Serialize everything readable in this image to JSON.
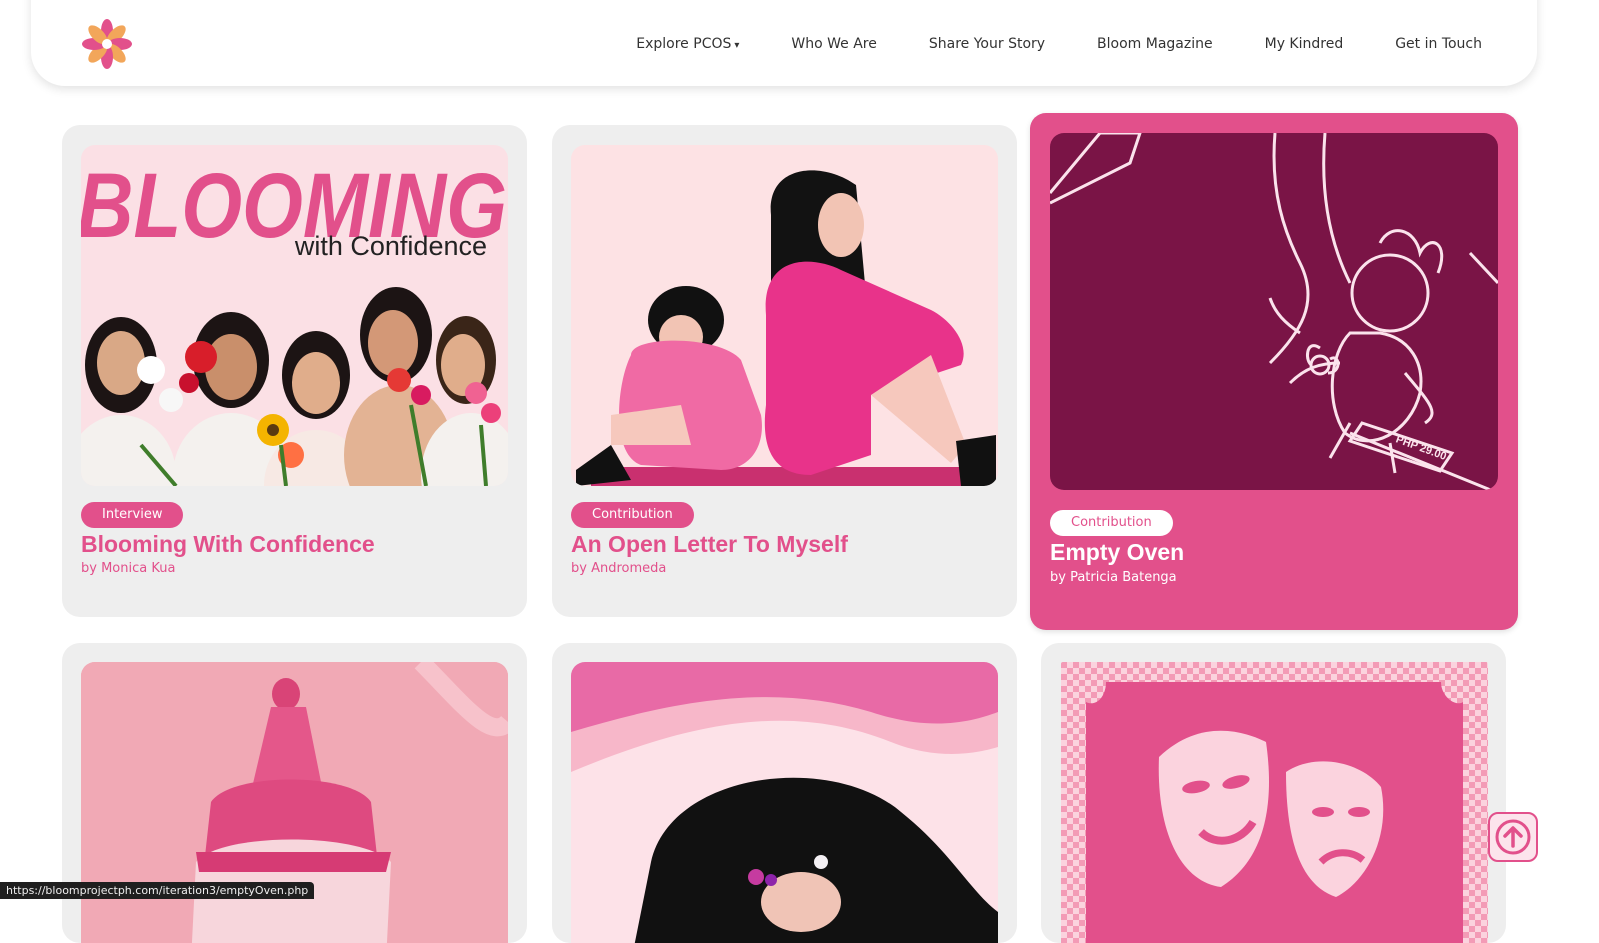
{
  "nav": {
    "logo_alt": "flower-logo",
    "links": [
      "Explore PCOS",
      "Who We Are",
      "Share Your Story",
      "Bloom Magazine",
      "My Kindred",
      "Get in Touch"
    ],
    "dropdown_caret": "▾"
  },
  "cards": [
    {
      "tag": "Interview",
      "title": "Blooming With Confidence",
      "author": "by Monica Kua",
      "image_text": {
        "headline": "BLOOMING",
        "sub": "with Confidence"
      }
    },
    {
      "tag": "Contribution",
      "title": "An Open Letter To Myself",
      "author": "by Andromeda"
    },
    {
      "tag": "Contribution",
      "title": "Empty Oven",
      "author": "by Patricia Batenga",
      "image_text": {
        "tag_text": "PHP 29.00"
      }
    }
  ],
  "status_url": "https://bloomprojectph.com/iteration3/emptyOven.php",
  "colors": {
    "accent": "#e2508b",
    "card_bg": "#eeeeee",
    "dark_plum": "#7a1446"
  }
}
